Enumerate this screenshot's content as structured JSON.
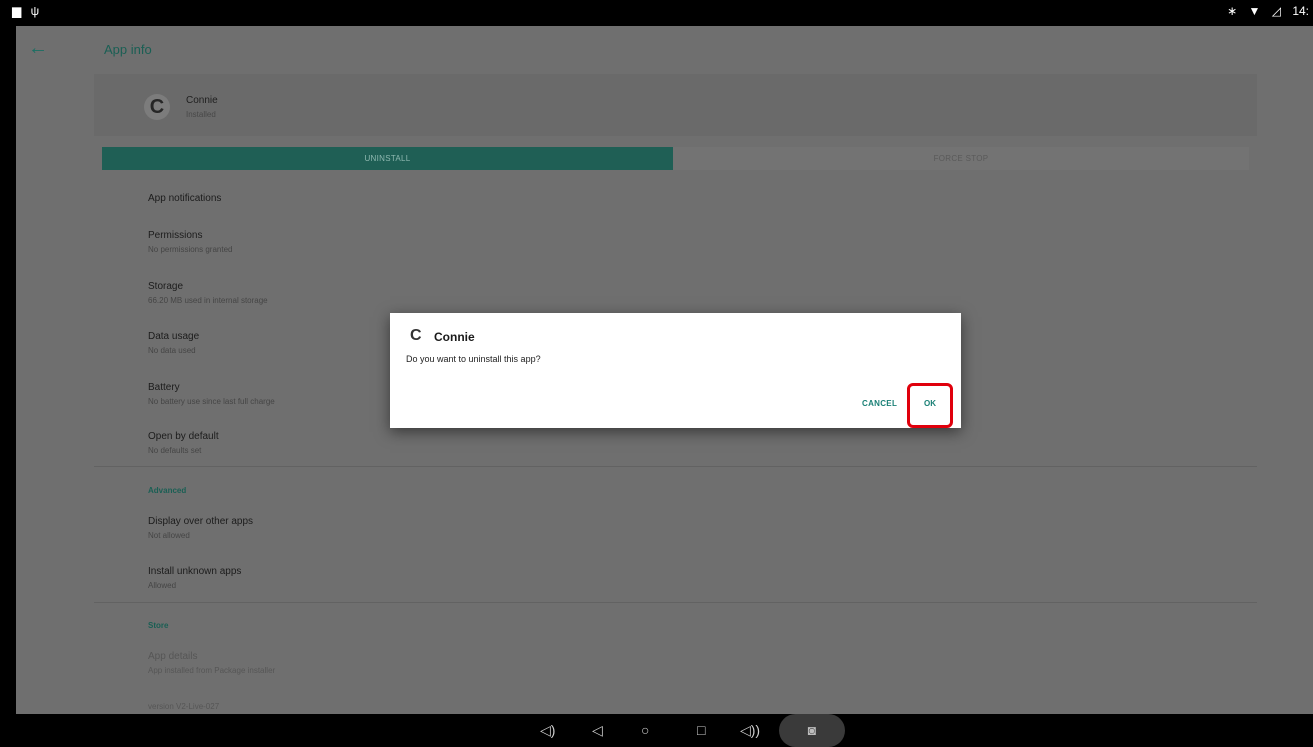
{
  "statusbar": {
    "left_icons": [
      "image-notification-icon",
      "usb-icon"
    ],
    "left_glyphs": [
      "▆",
      "ψ"
    ],
    "right_glyphs": [
      "∗",
      "▼",
      "◿"
    ],
    "time": "14:"
  },
  "toolbar": {
    "back_glyph": "←",
    "title": "App info"
  },
  "app": {
    "icon_glyph": "C",
    "name": "Connie",
    "status": "Installed"
  },
  "buttons": {
    "uninstall": "UNINSTALL",
    "force_stop": "FORCE STOP"
  },
  "prefs": [
    {
      "title": "App notifications",
      "subtitle": ""
    },
    {
      "title": "Permissions",
      "subtitle": "No permissions granted"
    },
    {
      "title": "Storage",
      "subtitle": "66.20 MB used in internal storage"
    },
    {
      "title": "Data usage",
      "subtitle": "No data used"
    },
    {
      "title": "Battery",
      "subtitle": "No battery use since last full charge"
    },
    {
      "title": "Open by default",
      "subtitle": "No defaults set"
    }
  ],
  "advanced": {
    "header": "Advanced",
    "items": [
      {
        "title": "Display over other apps",
        "subtitle": "Not allowed"
      },
      {
        "title": "Install unknown apps",
        "subtitle": "Allowed"
      }
    ]
  },
  "store": {
    "header": "Store",
    "app_details_title": "App details",
    "app_details_subtitle": "App installed from Package installer"
  },
  "version": "version V2-Live-027",
  "dialog": {
    "icon_glyph": "C",
    "title": "Connie",
    "message": "Do you want to uninstall this app?",
    "cancel": "CANCEL",
    "ok": "OK",
    "highlight_color": "#e0000c"
  },
  "navbar": {
    "volume_down_glyph": "◁)",
    "back_glyph": "◁",
    "home_glyph": "○",
    "recents_glyph": "□",
    "volume_up_glyph": "◁))",
    "screenshot_glyph": "◙"
  },
  "colors": {
    "accent": "#1f5f55",
    "dialog_button": "#1a8076"
  }
}
